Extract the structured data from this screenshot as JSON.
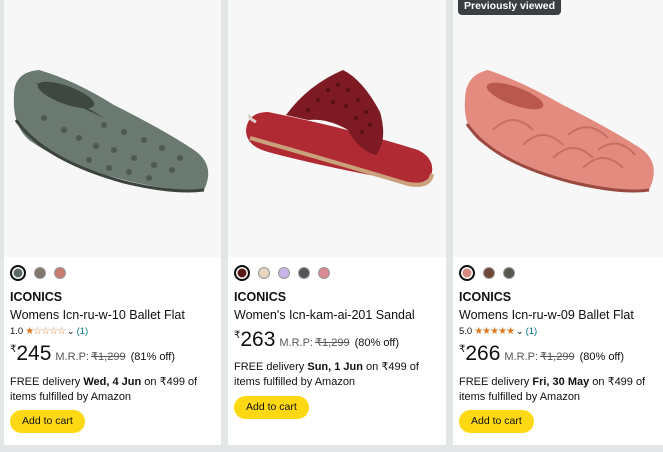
{
  "products": [
    {
      "brand": "ICONICS",
      "title": "Womens Icn-ru-w-10 Ballet Flat",
      "rating_value": "1.0",
      "rating_stars": "★☆☆☆☆",
      "rating_count": "(1)",
      "currency": "₹",
      "price": "245",
      "mrp_label": "M.R.P:",
      "mrp": "₹1,299",
      "discount": "(81% off)",
      "delivery_prefix": "FREE delivery ",
      "delivery_date": "Wed, 4 Jun",
      "delivery_suffix": " on ₹499 of items fulfilled by Amazon",
      "cart_label": "Add to cart",
      "swatches": [
        "#5c6b63",
        "#7f776c",
        "#c97b70"
      ],
      "shoe_color": "#6b7a70"
    },
    {
      "brand": "ICONICS",
      "title": "Women's Icn-kam-ai-201 Sandal",
      "currency": "₹",
      "price": "263",
      "mrp_label": "M.R.P:",
      "mrp": "₹1,299",
      "discount": "(80% off)",
      "delivery_prefix": "FREE delivery ",
      "delivery_date": "Sun, 1 Jun",
      "delivery_suffix": " on ₹499 of items fulfilled by Amazon",
      "cart_label": "Add to cart",
      "swatches": [
        "#5a1a1a",
        "#e9d5c0",
        "#c9b3e6",
        "#55535a",
        "#d98a94"
      ],
      "shoe_color": "#8a1f28"
    },
    {
      "badge": "Previously viewed",
      "brand": "ICONICS",
      "title": "Womens Icn-ru-w-09 Ballet Flat",
      "rating_value": "5.0",
      "rating_stars": "★★★★★",
      "rating_count": "(1)",
      "currency": "₹",
      "price": "266",
      "mrp_label": "M.R.P:",
      "mrp": "₹1,299",
      "discount": "(80% off)",
      "delivery_prefix": "FREE delivery ",
      "delivery_date": "Fri, 30 May",
      "delivery_suffix": " on ₹499 of items fulfilled by Amazon",
      "cart_label": "Add to cart",
      "swatches": [
        "#d98a80",
        "#6e4a36",
        "#55574e"
      ],
      "shoe_color": "#e38b7e"
    }
  ]
}
